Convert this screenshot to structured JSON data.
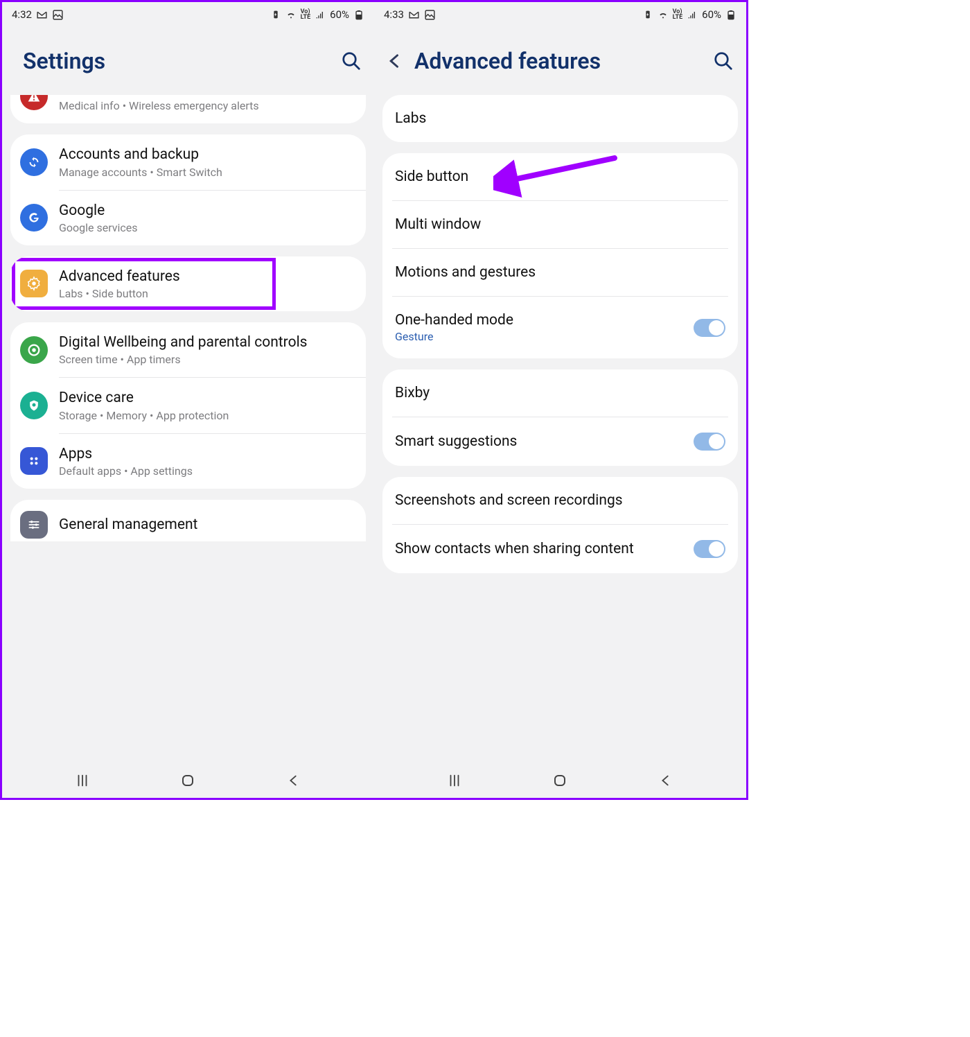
{
  "left": {
    "status": {
      "time": "4:32",
      "battery": "60%"
    },
    "header": {
      "title": "Settings"
    },
    "cutoff_row": {
      "sub": "Medical info  •  Wireless emergency alerts"
    },
    "group1": [
      {
        "title": "Accounts and backup",
        "sub": "Manage accounts  •  Smart Switch",
        "icon": "sync",
        "color": "#2f6fe0"
      },
      {
        "title": "Google",
        "sub": "Google services",
        "icon": "google",
        "color": "#2f6fe0"
      }
    ],
    "group2": [
      {
        "title": "Advanced features",
        "sub": "Labs  •  Side button",
        "icon": "gear",
        "color": "#f0ae3f",
        "highlight": true
      }
    ],
    "group3": [
      {
        "title": "Digital Wellbeing and parental controls",
        "sub": "Screen time  •  App timers",
        "icon": "target",
        "color": "#3aa64a"
      },
      {
        "title": "Device care",
        "sub": "Storage  •  Memory  •  App protection",
        "icon": "shield",
        "color": "#1bb092"
      },
      {
        "title": "Apps",
        "sub": "Default apps  •  App settings",
        "icon": "grid4",
        "color": "#3657d6"
      }
    ],
    "group4": [
      {
        "title": "General management",
        "sub": "",
        "icon": "sliders",
        "color": "#6a6e80"
      }
    ]
  },
  "right": {
    "status": {
      "time": "4:33",
      "battery": "60%"
    },
    "header": {
      "title": "Advanced features"
    },
    "grp1": [
      {
        "title": "Labs"
      }
    ],
    "grp2": [
      {
        "title": "Side button",
        "arrow": true
      },
      {
        "title": "Multi window"
      },
      {
        "title": "Motions and gestures"
      },
      {
        "title": "One-handed mode",
        "sub": "Gesture",
        "toggle": true
      }
    ],
    "grp3": [
      {
        "title": "Bixby"
      },
      {
        "title": "Smart suggestions",
        "toggle": true
      }
    ],
    "grp4": [
      {
        "title": "Screenshots and screen recordings"
      },
      {
        "title": "Show contacts when sharing content",
        "toggle": true
      }
    ]
  }
}
